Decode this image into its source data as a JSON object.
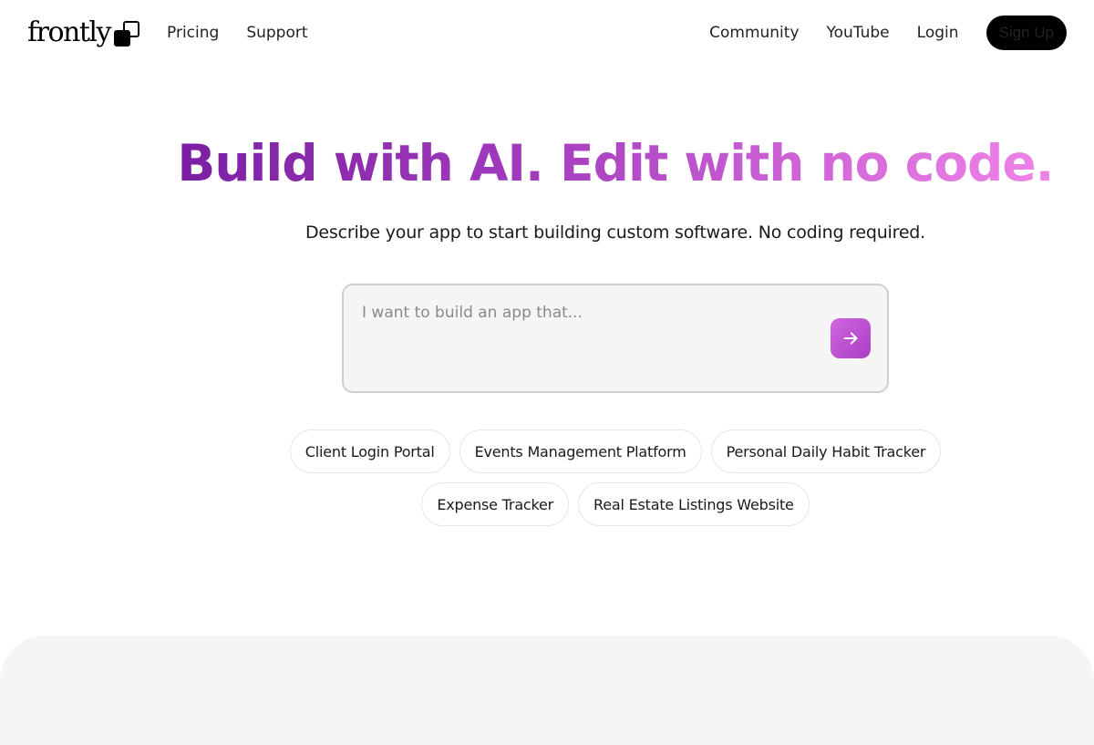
{
  "nav": {
    "logo_text": "frontly",
    "left_links": [
      "Pricing",
      "Support"
    ],
    "right_links": [
      "Community",
      "YouTube",
      "Login"
    ],
    "signup_label": "Sign Up"
  },
  "hero": {
    "headline": "Build with AI. Edit with no code.",
    "subheadline": "Describe your app to start building custom software. No coding required.",
    "prompt_placeholder": "I want to build an app that...",
    "submit_icon": "arrow-right-icon"
  },
  "suggestions": {
    "row1": [
      "Client Login Portal",
      "Events Management Platform",
      "Personal Daily Habit Tracker"
    ],
    "row2": [
      "Expense Tracker",
      "Real Estate Listings Website"
    ]
  },
  "colors": {
    "accent_start": "#7b1fa2",
    "accent_end": "#ee84e8",
    "button_dark": "#000000",
    "panel_gray": "#f5f5f5"
  }
}
